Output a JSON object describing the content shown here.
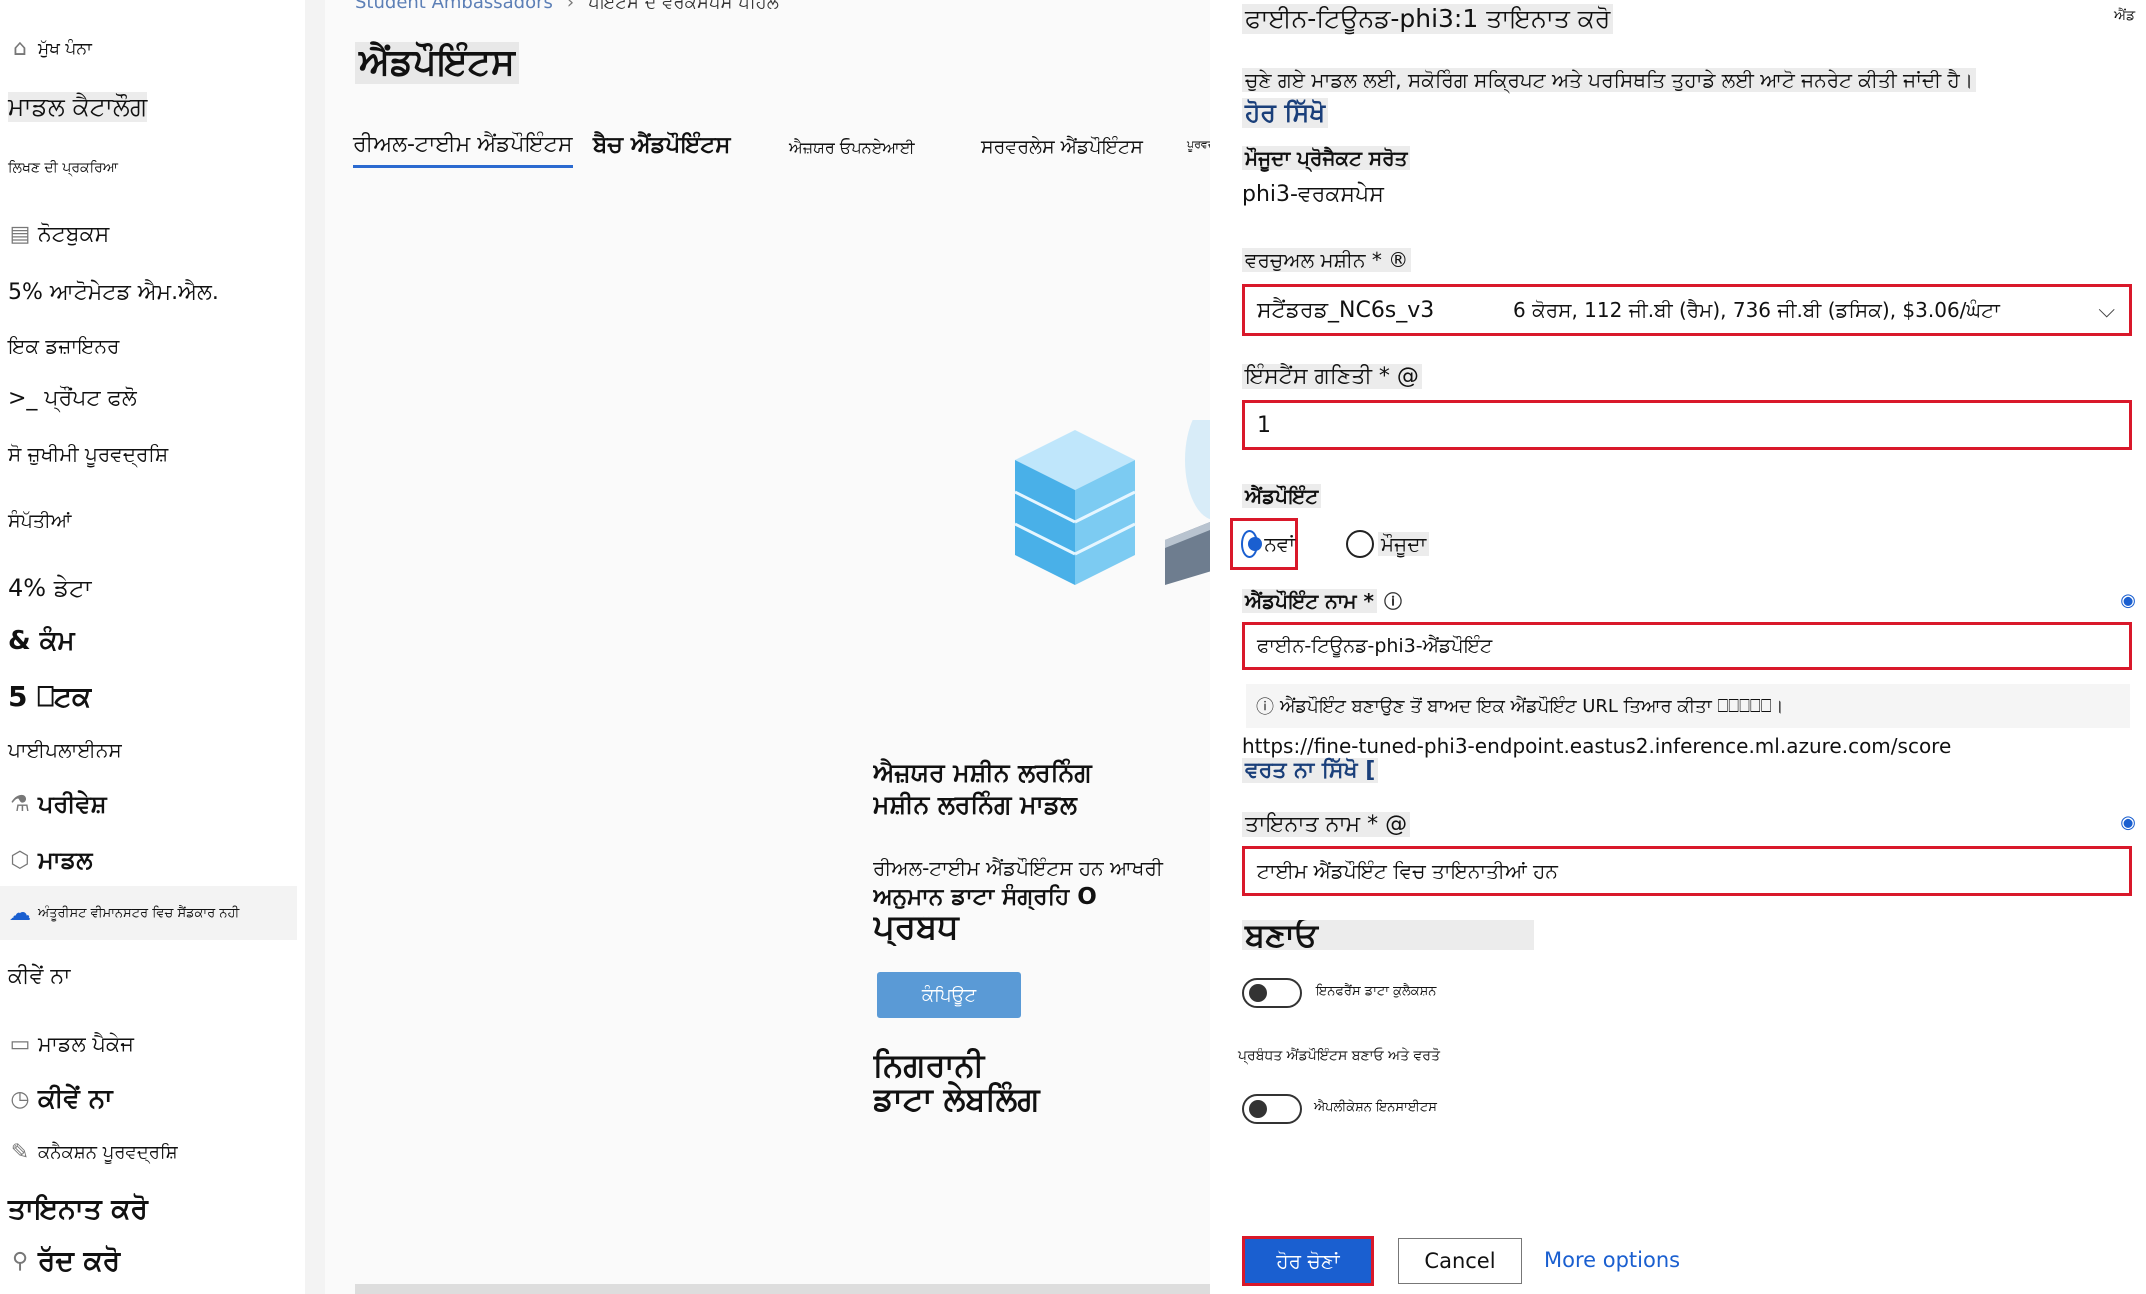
{
  "sidebar": {
    "items": [
      {
        "label": "ਮੁੱਖ ਪੰਨਾ",
        "icon": "home-icon"
      },
      {
        "label": "ਮਾਡਲ ਕੈਟਾਲੌਗ"
      },
      {
        "label": "ਲਿਖਣ ਦੀ ਪ੍ਰਕਰਿਆ"
      },
      {
        "label": "ਨੋਟਬੁਕਸ",
        "icon": "notebook-icon"
      },
      {
        "label": "5% ਆਟੋਮੇਟਡ ਐਮ.ਐਲ."
      },
      {
        "label": "ਇਕ ਡਜ਼ਾਇਨਰ"
      },
      {
        "label": ">_ ਪ੍ਰੌਂਪਟ ਫਲੋ"
      },
      {
        "label": "ਸੋ ਜ਼ੁਖੀਮੀ ਪੂਰਵਦ੍ਰਸ਼ਿ"
      },
      {
        "label": "ਸੰਪੱਤੀਆਂ"
      },
      {
        "label": "4% ਡੇਟਾ"
      },
      {
        "label": "& ਕੰਮ"
      },
      {
        "label": "5 ⎕ਟਕ"
      },
      {
        "label": "ਪਾਈਪਲਾਈਨਸ"
      },
      {
        "label": "ਪਰੀਵੇਸ਼",
        "icon": "flask-icon"
      },
      {
        "label": "ਮਾਡਲ",
        "icon": "cube-icon"
      },
      {
        "label": "ਅੰਤੂਰੀਸਟ ਵੀਮਾਨਸਟਰ ਵਿਚ ਸੈਂਡਕਾਰ ਨਹੀ",
        "icon": "endpoint-icon"
      },
      {
        "label": "ਕੀਵੇਂ ਨਾ"
      },
      {
        "label": "ਮਾਡਲ ਪੈਕੇਜ",
        "icon": "monitor-icon"
      },
      {
        "label": "ਕੀਵੇਂ ਨਾ",
        "icon": "gauge-icon"
      },
      {
        "label": "ਕਨੈਕਸ਼ਨ ਪੂਰਵਦ੍ਰਸ਼ਿ",
        "icon": "edit-icon"
      },
      {
        "label": "ਤਾਇਨਾਤ ਕਰੋ"
      },
      {
        "label": "ਰੱਦ ਕਰੋ",
        "icon": "link-icon"
      }
    ]
  },
  "main": {
    "breadcrumbs": [
      "Student Ambassadors",
      "ਪੌਂਇੰਟਸ ਦੇ ਵਰਕਸਪੇਸ ਪਹਿਲੇ"
    ],
    "title": "ਐਂਡਪੌਇੰਟਸ",
    "tabs": [
      {
        "label": "ਰੀਅਲ-ਟਾਈਮ ਐਂਡਪੌਇੰਟਸ"
      },
      {
        "label": "ਬੈਚ ਐਂਡਪੌਇੰਟਸ"
      },
      {
        "label": "ਐਜ਼ਯਰ ਓਪਨਏਆਈ"
      },
      {
        "label": "ਸਰਵਰਲੇਸ ਐਂਡਪੌਇੰਟਸ"
      },
      {
        "label": "ਪੂਰਵਦ੍ਰਸ਼ਿ"
      }
    ],
    "hero_heading_1": "ਐਜ਼ਯਰ ਮਸ਼ੀਨ ਲਰਨਿੰਗ",
    "hero_heading_2": "ਮਸ਼ੀਨ ਲਰਨਿੰਗ ਮਾਡਲ",
    "hero_text_1": "ਰੀਅਲ-ਟਾਈਮ ਐਂਡਪੌਇੰਟਸ ਹਨ ਆਖਰੀ",
    "hero_text_2": "ਅਨੁਮਾਨ ਡਾਟਾ ਸੰਗ੍ਰਹਿ O",
    "hero_text_3": "ਪ੍ਰਬੰਧ",
    "create_button": "ਕੰਪਿਊਟ",
    "footer_1": "ਨਿਗਰਾਨੀ",
    "footer_2": "ਡਾਟਾ ਲੇਬਲਿੰਗ"
  },
  "panel": {
    "title": "ਫਾਈਨ-ਟਿਊਨਡ-phi3:1 ਤਾਇਨਾਤ ਕਰੋ",
    "close_label": "ਐਂਡ",
    "description": "ਚੁਣੇ ਗਏ ਮਾਡਲ ਲਈ, ਸਕੋਰਿੰਗ ਸਕ੍ਰਿਪਟ ਅਤੇ ਪਰਸਿਥਤਿ ਤੁਹਾਡੇ ਲਈ ਆਟੋ ਜਨਰੇਟ ਕੀਤੀ ਜਾਂਦੀ ਹੈ।",
    "learn_more": "ਹੋਰ ਸਿੱਖੋ",
    "project_label": "ਮੌਜੂਦਾ ਪ੍ਰੋਜੈਕਟ ਸਰੋਤ",
    "project_value": "phi3-ਵਰਕਸਪੇਸ",
    "vm_label": "ਵਰਚੁਅਲ ਮਸ਼ੀਨ * ®",
    "vm_name": "ਸਟੈਂਡਰਡ_NC6s_v3",
    "vm_spec": "6 ਕੋਰਸ, 112 ਜੀ.ਬੀ (ਰੈਮ), 736 ਜੀ.ਬੀ (ਡਸਿਕ), $3.06/ਘੰਟਾ",
    "instance_label": "ਇੰਸਟੈਂਸ ਗਣਿਤੀ * @",
    "instance_value": "1",
    "endpoint_section": "ਐਂਡਪੌਇੰਟ",
    "radio_new": "ਨਵਾਂ",
    "radio_existing": "ਮੌਜੂਦਾ",
    "endpoint_name_label": "ਐਂਡਪੌਇੰਟ ਨਾਮ *",
    "endpoint_name_value": "ਫਾਈਨ-ਟਿਊਨਡ-phi3-ਐਂਡਪੌਇੰਟ",
    "info_text": "ਐਂਡਪੌਇੰਟ ਬਣਾਉਣ ਤੋਂ ਬਾਅਦ ਇਕ ਐਂਡਪੌਇੰਟ URL ਤਿਆਰ ਕੀਤਾ ⎕⎕⎕⎕⎕।",
    "endpoint_url": "https://fine-tuned-phi3-endpoint.eastus2.inference.ml.azure.com/score",
    "use_learn": "ਵਰਤ ਨਾ ਸਿੱਖੋ [",
    "deploy_name_label": "ਤਾਇਨਾਤ ਨਾਮ * @",
    "deploy_name_value": "ਟਾਈਮ ਐਂਡਪੌਇੰਟ ਵਿਚ ਤਾਇਨਾਤੀਆਂ ਹਨ",
    "create_heading": "ਬਣਾਓ",
    "toggle1_label": "ਇਨਫਰੈਂਸ ਡਾਟਾ ਕੁਲੈਕਸ਼ਨ",
    "managed_label": "ਪ੍ਰਬੰਧਤ ਐਂਡਪੌਇੰਟਸ ਬਣਾਓ ਅਤੇ ਵਰਤੋ",
    "toggle2_label": "ਐਪਲੀਕੇਸ਼ਨ ਇਨਸਾਈਟਸ",
    "btn_next": "ਹੋਰ ਚੋਣਾਂ",
    "btn_cancel": "Cancel",
    "btn_more": "More options"
  }
}
